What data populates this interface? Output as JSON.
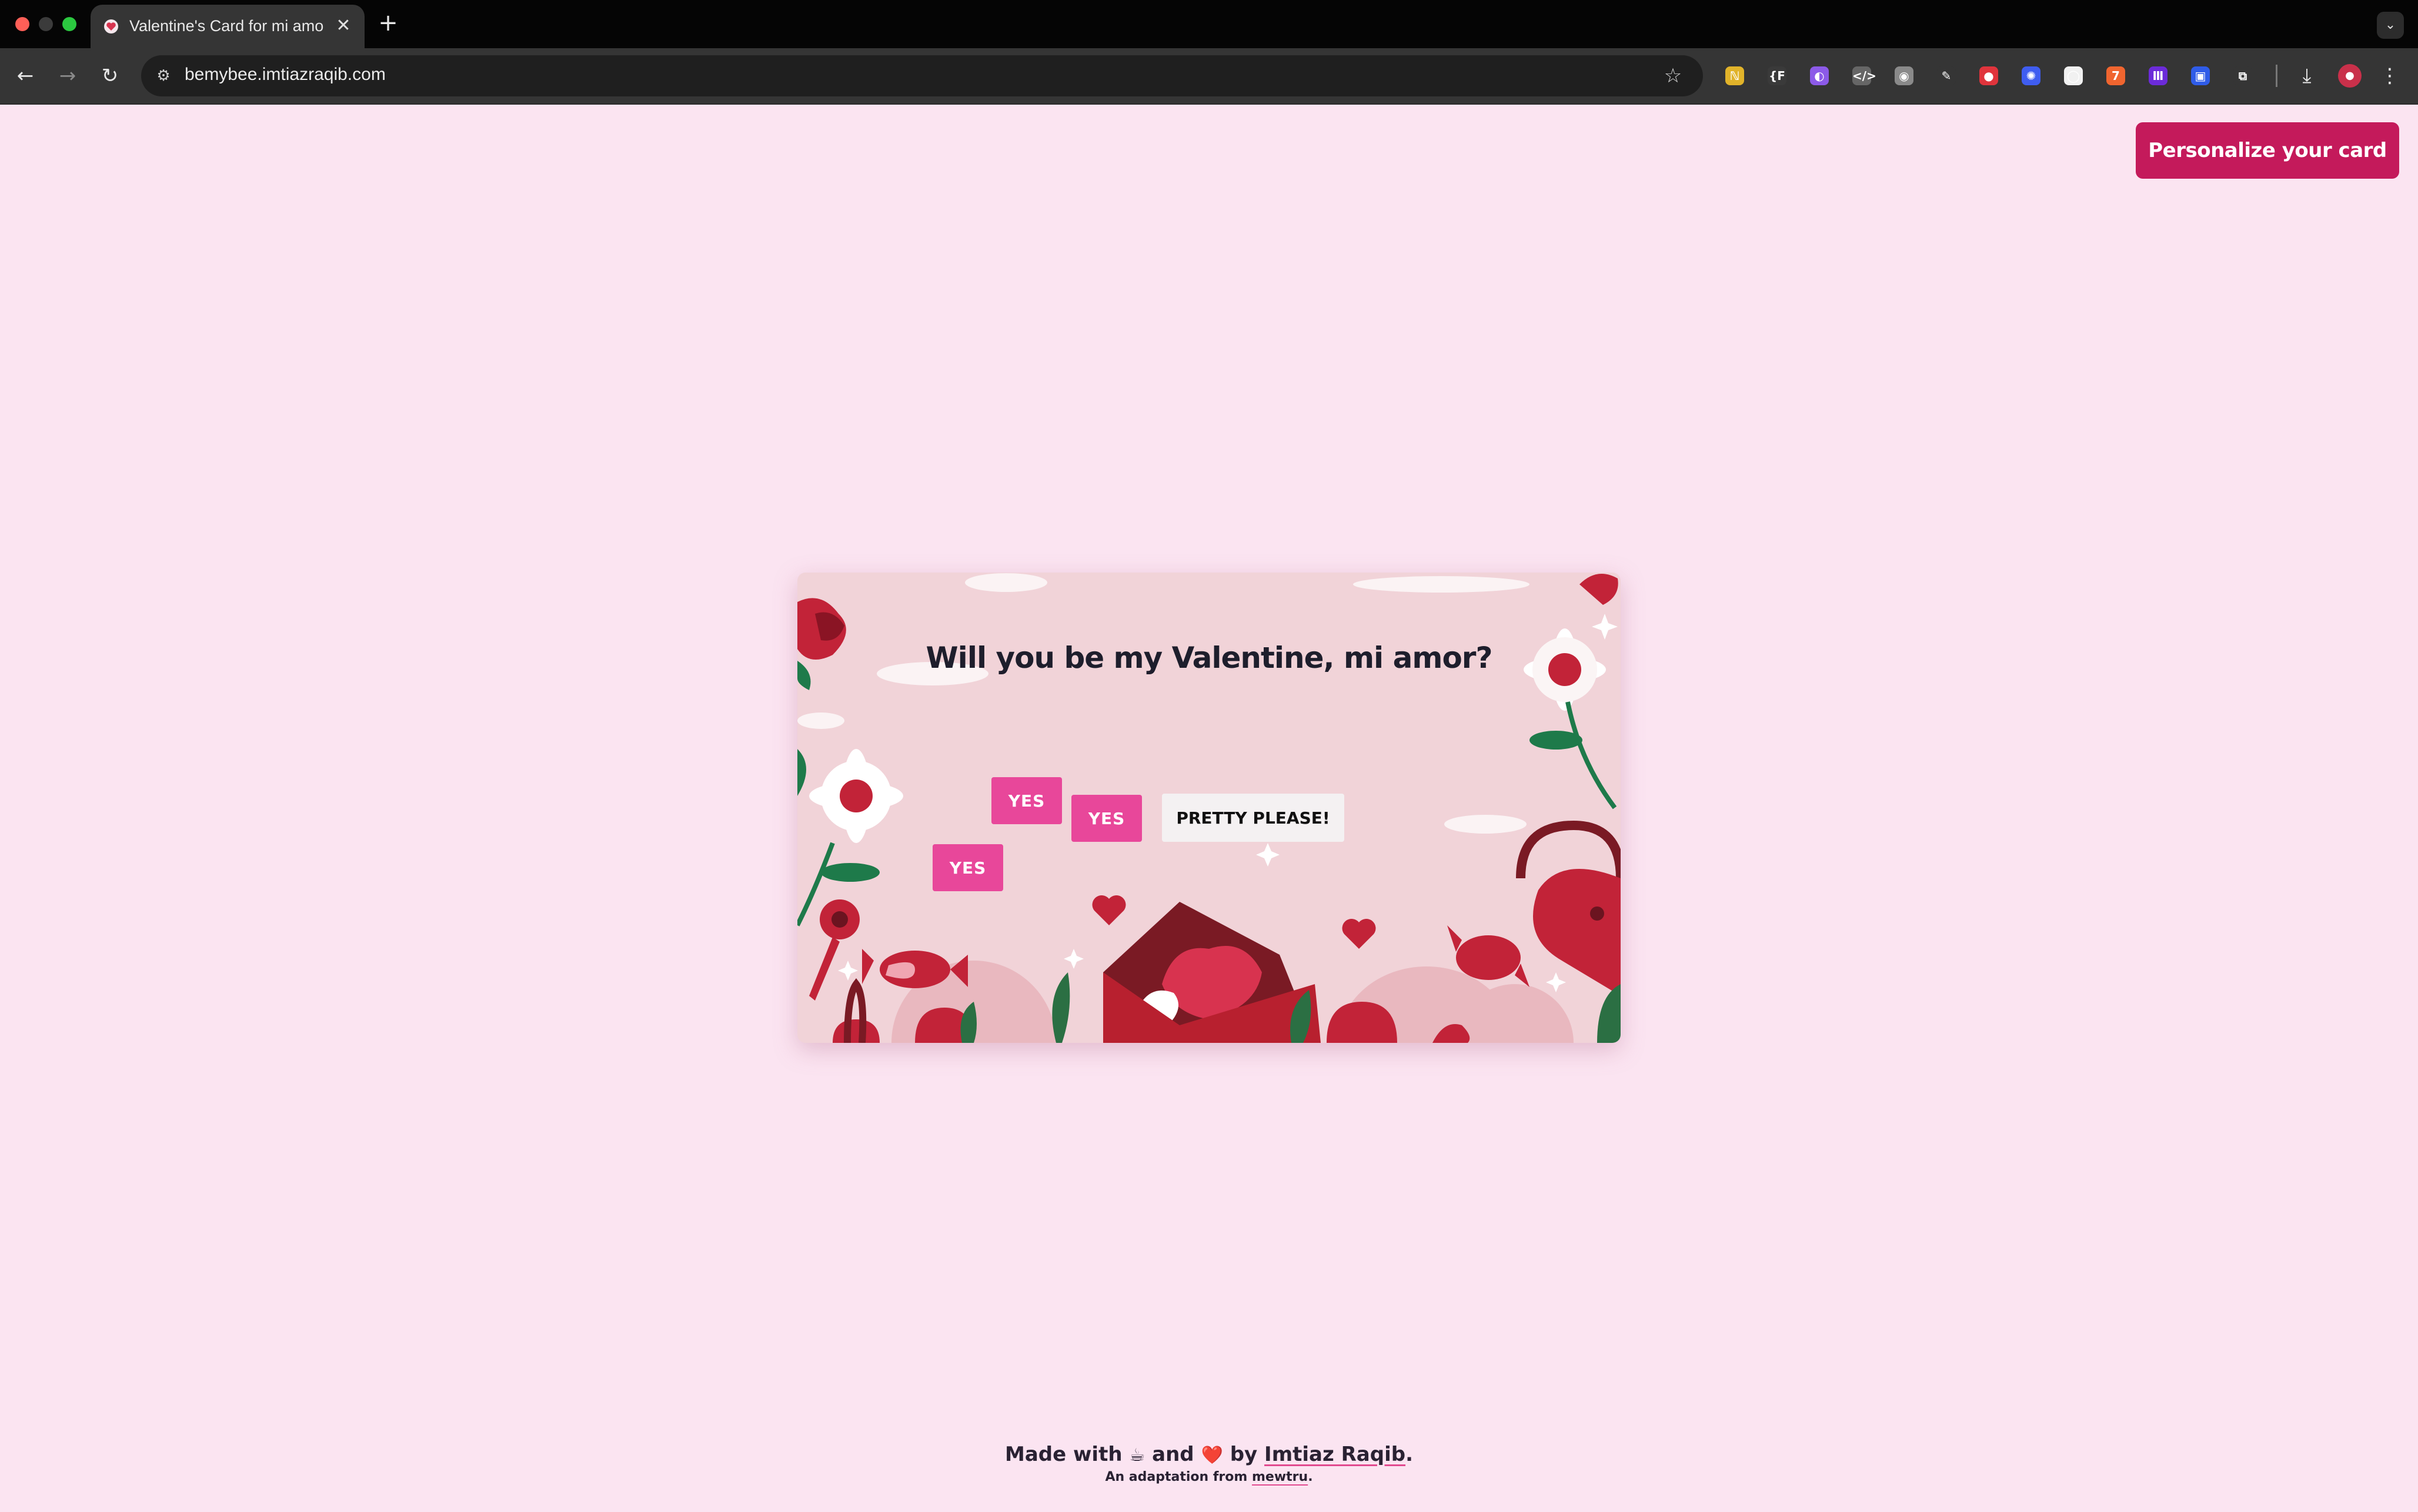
{
  "browser": {
    "tab_title": "Valentine's Card for mi amor",
    "url": "bemybee.imtiazraqib.com",
    "extensions": [
      {
        "name": "extension-1",
        "glyph": "ℕ",
        "color": "#e1b32a"
      },
      {
        "name": "extension-2",
        "glyph": "{F",
        "color": "#3a3a3a"
      },
      {
        "name": "extension-3",
        "glyph": "◐",
        "color": "#8c5ae8"
      },
      {
        "name": "extension-4",
        "glyph": "</>",
        "color": "#666666"
      },
      {
        "name": "camera-extension",
        "glyph": "◉",
        "color": "#8a8a8a"
      },
      {
        "name": "eyedropper-extension",
        "glyph": "✎",
        "color": "#353535"
      },
      {
        "name": "extension-7",
        "glyph": "●",
        "color": "#e0343c"
      },
      {
        "name": "extension-8",
        "glyph": "✺",
        "color": "#3f5df0"
      },
      {
        "name": "extension-9",
        "glyph": "◯",
        "color": "#f1f1f1"
      },
      {
        "name": "extension-10",
        "glyph": "7",
        "color": "#f0652f"
      },
      {
        "name": "extension-11",
        "glyph": "Ⅲ",
        "color": "#6c2bd9"
      },
      {
        "name": "extension-12",
        "glyph": "▣",
        "color": "#2f5ce8"
      },
      {
        "name": "puzzle-icon",
        "glyph": "⧉",
        "color": "#353535"
      }
    ]
  },
  "page": {
    "personalize_label": "Personalize your card",
    "question": "Will you be my Valentine, mi amor?",
    "yes_labels": [
      "YES",
      "YES",
      "YES"
    ],
    "pretty_please_label": "PRETTY PLEASE!",
    "footer": {
      "made_with": "Made with",
      "coffee": "☕",
      "and": "and",
      "heart": "❤️",
      "by": "by",
      "author": "Imtiaz Raqib",
      "period": ".",
      "adaptation": "An adaptation from",
      "source": "mewtru",
      "period2": "."
    }
  },
  "colors": {
    "page_bg": "#fbe4f1",
    "accent": "#c41a5b",
    "yes_button": "#e8479a"
  }
}
